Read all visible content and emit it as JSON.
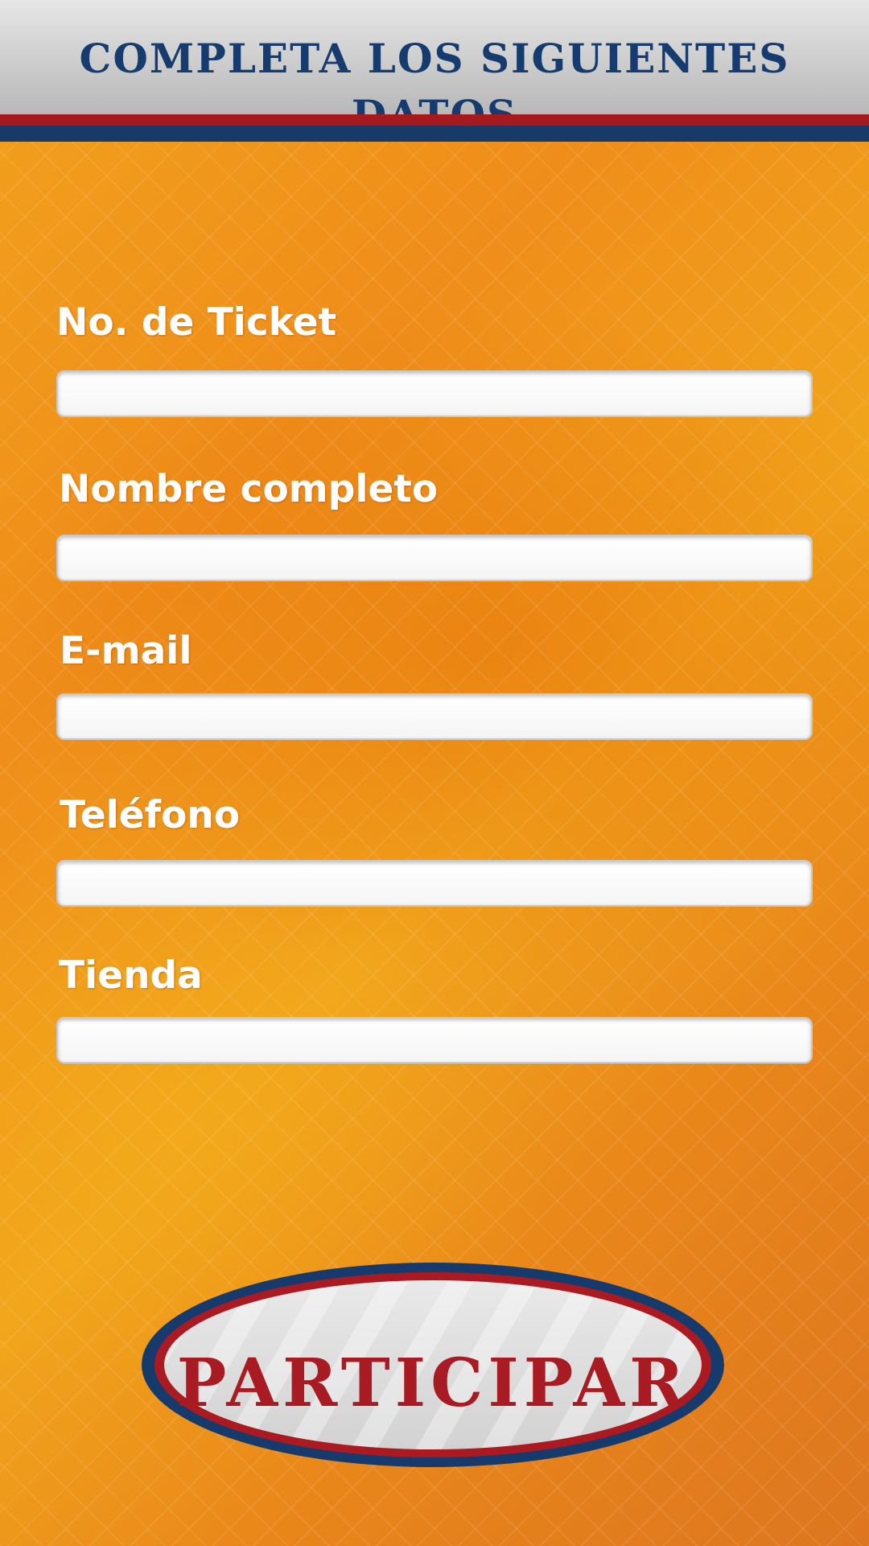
{
  "header": {
    "title": "COMPLETA LOS SIGUIENTES DATOS"
  },
  "form": {
    "fields": [
      {
        "label": "No. de Ticket",
        "value": "",
        "placeholder": ""
      },
      {
        "label": "Nombre completo",
        "value": "",
        "placeholder": ""
      },
      {
        "label": "E-mail",
        "value": "",
        "placeholder": ""
      },
      {
        "label": "Teléfono",
        "value": "",
        "placeholder": ""
      },
      {
        "label": "Tienda",
        "value": "",
        "placeholder": ""
      }
    ]
  },
  "submit": {
    "label": "PARTICIPAR"
  },
  "colors": {
    "header_text": "#163b6e",
    "stripe_red": "#a8191f",
    "stripe_blue": "#183a68",
    "background_orange": "#ef8d1a",
    "button_text": "#a81b22"
  }
}
